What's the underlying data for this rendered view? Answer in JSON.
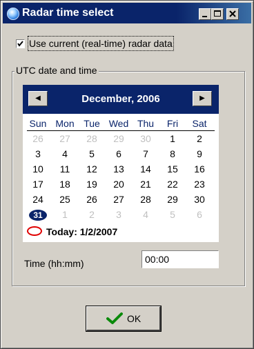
{
  "window": {
    "title": "Radar time select"
  },
  "realtime_checkbox": {
    "label": "Use current (real-time) radar data",
    "checked": true
  },
  "group": {
    "legend": "UTC date and time"
  },
  "calendar": {
    "month_year": "December, 2006",
    "prev_icon": "triangle-left-icon",
    "next_icon": "triangle-right-icon",
    "weekdays": [
      "Sun",
      "Mon",
      "Tue",
      "Wed",
      "Thu",
      "Fri",
      "Sat"
    ],
    "weeks": [
      [
        "26",
        "27",
        "28",
        "29",
        "30",
        "1",
        "2"
      ],
      [
        "3",
        "4",
        "5",
        "6",
        "7",
        "8",
        "9"
      ],
      [
        "10",
        "11",
        "12",
        "13",
        "14",
        "15",
        "16"
      ],
      [
        "17",
        "18",
        "19",
        "20",
        "21",
        "22",
        "23"
      ],
      [
        "24",
        "25",
        "26",
        "27",
        "28",
        "29",
        "30"
      ],
      [
        "31",
        "1",
        "2",
        "3",
        "4",
        "5",
        "6"
      ]
    ],
    "selected_day": "31",
    "today_label": "Today: 1/2/2007",
    "colors": {
      "header": "#0a246a",
      "dim": "#bfbfbf",
      "today_circle": "#e00000"
    }
  },
  "time": {
    "label": "Time (hh:mm)",
    "value": "00:00"
  },
  "ok_button": {
    "label": "OK",
    "icon": "green-checkmark-icon"
  }
}
